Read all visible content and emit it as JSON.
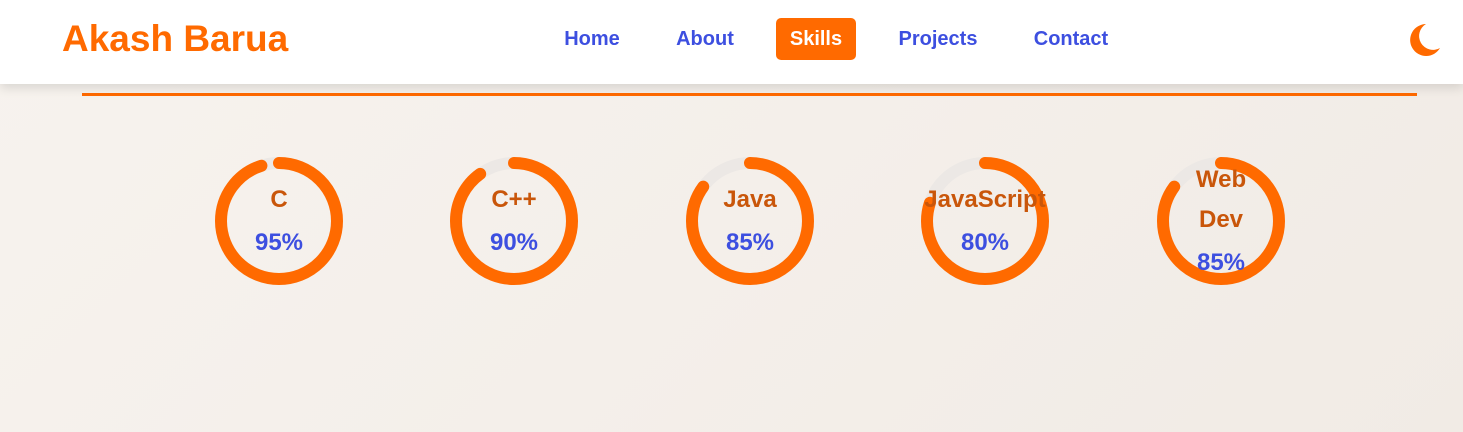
{
  "brand": "Akash Barua",
  "nav": {
    "links": [
      {
        "label": "Home",
        "active": false
      },
      {
        "label": "About",
        "active": false
      },
      {
        "label": "Skills",
        "active": true
      },
      {
        "label": "Projects",
        "active": false
      },
      {
        "label": "Contact",
        "active": false
      }
    ],
    "theme_icon": "moon-icon"
  },
  "colors": {
    "accent": "#ff6a00",
    "link": "#3d4fe0",
    "skill_name": "#c9560a",
    "ring_track": "#ece8e5"
  },
  "skills": [
    {
      "name": "C",
      "percent_label": "95%",
      "percent": 95
    },
    {
      "name": "C++",
      "percent_label": "90%",
      "percent": 90
    },
    {
      "name": "Java",
      "percent_label": "85%",
      "percent": 85
    },
    {
      "name": "JavaScript",
      "percent_label": "80%",
      "percent": 80
    },
    {
      "name": "Web Dev",
      "name_lines": [
        "Web",
        "Dev"
      ],
      "percent_label": "85%",
      "percent": 85
    }
  ]
}
